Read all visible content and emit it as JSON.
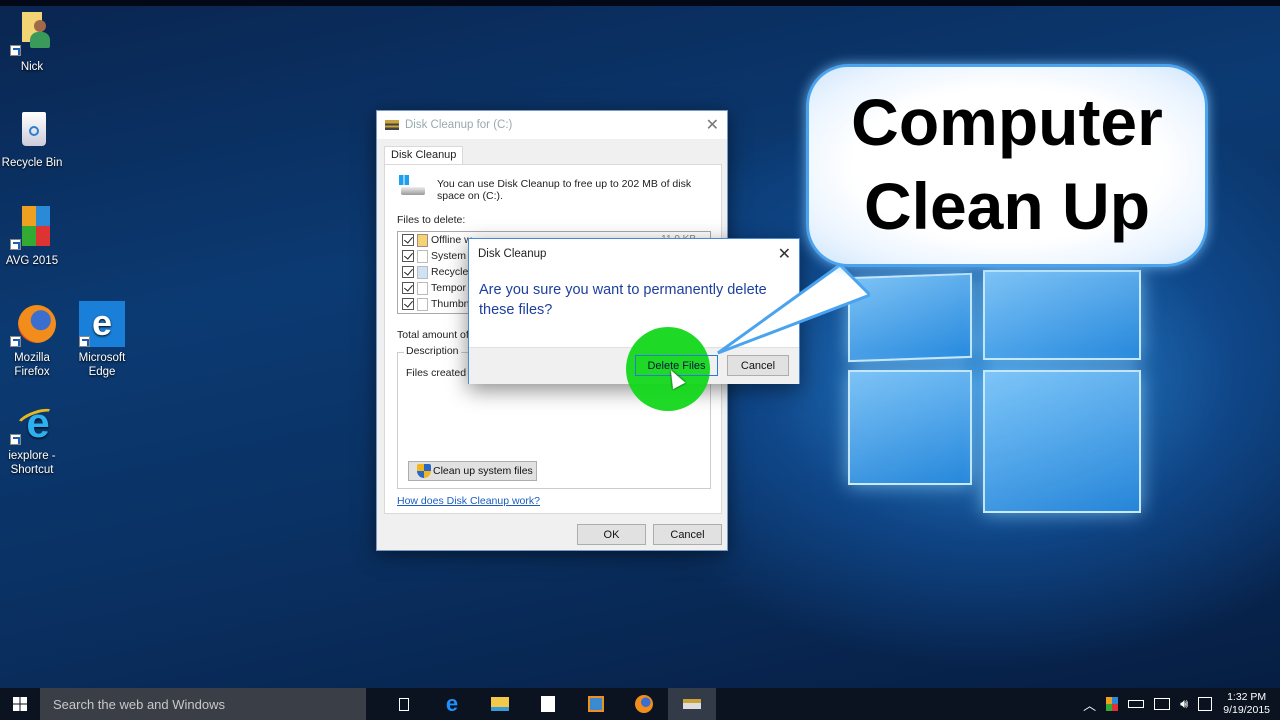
{
  "desktop": {
    "icons": [
      {
        "label": "Nick",
        "icon": "user-folder-icon"
      },
      {
        "label": "Recycle Bin",
        "icon": "recycle-bin-icon"
      },
      {
        "label": "AVG 2015",
        "icon": "avg-icon"
      },
      {
        "label": "Mozilla Firefox",
        "line1": "Mozilla",
        "line2": "Firefox",
        "icon": "firefox-icon"
      },
      {
        "label": "Microsoft Edge",
        "line1": "Microsoft",
        "line2": "Edge",
        "icon": "edge-icon"
      },
      {
        "label": "iexplore - Shortcut",
        "line1": "iexplore -",
        "line2": "Shortcut",
        "icon": "internet-explorer-icon"
      }
    ]
  },
  "disk_cleanup": {
    "title": "Disk Cleanup for  (C:)",
    "tab": "Disk Cleanup",
    "intro": "You can use Disk Cleanup to free up to 202 MB of disk space on  (C:).",
    "files_label": "Files to delete:",
    "files": [
      {
        "name": "Offline w",
        "checked": true,
        "size": "11.0 KB"
      },
      {
        "name": "System",
        "checked": true
      },
      {
        "name": "Recycle",
        "checked": true
      },
      {
        "name": "Tempor",
        "checked": true
      },
      {
        "name": "Thumbn",
        "checked": true
      }
    ],
    "total_label": "Total amount of",
    "description_legend": "Description",
    "description_text": "Files created b",
    "clean_system_button": "Clean up system files",
    "help_link": "How does Disk Cleanup work?",
    "ok_button": "OK",
    "cancel_button": "Cancel"
  },
  "confirm": {
    "title": "Disk Cleanup",
    "message": "Are you sure you want to permanently delete these files?",
    "delete_button": "Delete Files",
    "cancel_button": "Cancel",
    "highlight_color": "#12d71a"
  },
  "callout": {
    "line1": "Computer",
    "line2": "Clean Up"
  },
  "taskbar": {
    "search_placeholder": "Search the web and Windows",
    "time": "1:32 PM",
    "date": "9/19/2015"
  }
}
